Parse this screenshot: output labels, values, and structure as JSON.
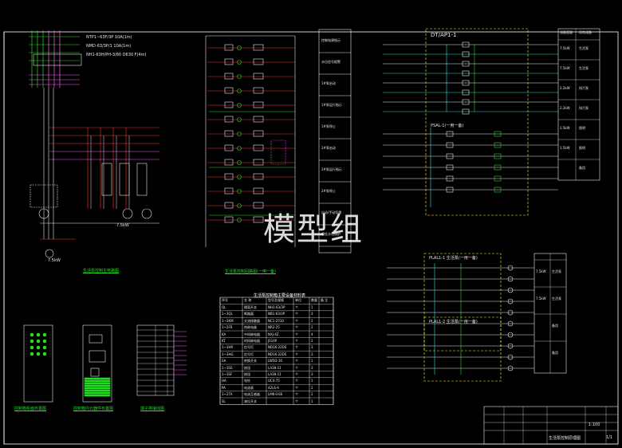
{
  "watermark": "模型组",
  "colors": {
    "bg": "#000000",
    "frame": "#ffffff",
    "green": "#22dd22",
    "red": "#ff3333",
    "magenta": "#ff55ff",
    "cyan": "#33dddd",
    "yellow": "#ffff33",
    "white": "#e8e8e8"
  },
  "main_circuit": {
    "title": "生活泵控制主电路图",
    "motor_power": "7.5kW",
    "breaker_labels": [
      "NTP1~63F/3P 10A(1m)",
      "NMD-63/3P/1 10A(1m)",
      "NH1-63H/PH-3/80 D630 F(4m)"
    ]
  },
  "control_circuit": {
    "title": "生活泵控制回路图(一用一备)",
    "func_labels": [
      "控制电源指示",
      "水位信号报警",
      "1#泵启动",
      "1#泵运行指示",
      "1#泵停止",
      "2#泵启动",
      "2#泵运行指示",
      "2#泵停止",
      "自动/手动切换",
      "超低水位保护"
    ]
  },
  "equipment_table": {
    "title": "生活泵控制箱主要设备材料表",
    "headers": [
      "序号",
      "名 称",
      "型号及规格",
      "单位",
      "数量",
      "备 注"
    ],
    "rows": [
      [
        "QL",
        "隔离开关",
        "NH1-63/3P",
        "个",
        "1",
        ""
      ],
      [
        "1~3QL",
        "断路器",
        "NB1-63/3P",
        "个",
        "3",
        ""
      ],
      [
        "1~3KM",
        "交流接触器",
        "NC1-2510",
        "个",
        "2",
        ""
      ],
      [
        "1~2FR",
        "热继电器",
        "NR2-25",
        "个",
        "2",
        ""
      ],
      [
        "KA",
        "中间继电器",
        "NXJ-4Z",
        "个",
        "4",
        ""
      ],
      [
        "KT",
        "时间继电器",
        "JS14P",
        "个",
        "2",
        ""
      ],
      [
        "1~3HR",
        "信号灯",
        "ND16-22DS",
        "个",
        "3",
        ""
      ],
      [
        "1~3HG",
        "信号灯",
        "ND16-22DS",
        "个",
        "3",
        ""
      ],
      [
        "SA",
        "转换开关",
        "LW5D-16",
        "个",
        "1",
        ""
      ],
      [
        "1~3SS",
        "按钮",
        "LA38-11",
        "个",
        "3",
        ""
      ],
      [
        "1~3SF",
        "按钮",
        "LA38-11",
        "个",
        "3",
        ""
      ],
      [
        "HA",
        "电铃",
        "UC4-75",
        "个",
        "1",
        ""
      ],
      [
        "PA",
        "电流表",
        "42L6-A",
        "个",
        "2",
        ""
      ],
      [
        "1~2TA",
        "电流互感器",
        "LMK-0.66",
        "个",
        "2",
        ""
      ],
      [
        "SL",
        "液位开关",
        "",
        "个",
        "1",
        ""
      ]
    ]
  },
  "panel_titles": [
    "控制箱柜面布置图",
    "控制箱内元器件布置图",
    "端子排接线图"
  ],
  "distribution": {
    "box_label": "DT/AP1-1",
    "box2_label": "PSAL-1(一用一备)",
    "box3_label": "PLAL1-1 生活泵(一用一备)",
    "box4_label": "PLAL1-2 生活泵(一用一备)",
    "right_table_headers": [
      "回路编号",
      "设备容量",
      "用电设备"
    ],
    "right_rows": [
      [
        "N1",
        "7.5kW",
        "生活泵"
      ],
      [
        "N2",
        "7.5kW",
        "生活泵"
      ],
      [
        "N3",
        "2.2kW",
        "排污泵"
      ],
      [
        "N4",
        "2.2kW",
        "排污泵"
      ],
      [
        "N5",
        "1.5kW",
        "照明"
      ],
      [
        "N6",
        "1.5kW",
        "照明"
      ],
      [
        "N7",
        "",
        "备用"
      ]
    ],
    "lower_right_rows": [
      [
        "N1",
        "7.5kW",
        "生活泵"
      ],
      [
        "N2",
        "7.5kW",
        "生活泵"
      ],
      [
        "N3",
        "",
        "备用"
      ],
      [
        "N4",
        "",
        "备用"
      ]
    ]
  },
  "title_block": {
    "drawing_name": "生活泵控制原理图",
    "scale": "1:100",
    "sheet": "1/1"
  }
}
